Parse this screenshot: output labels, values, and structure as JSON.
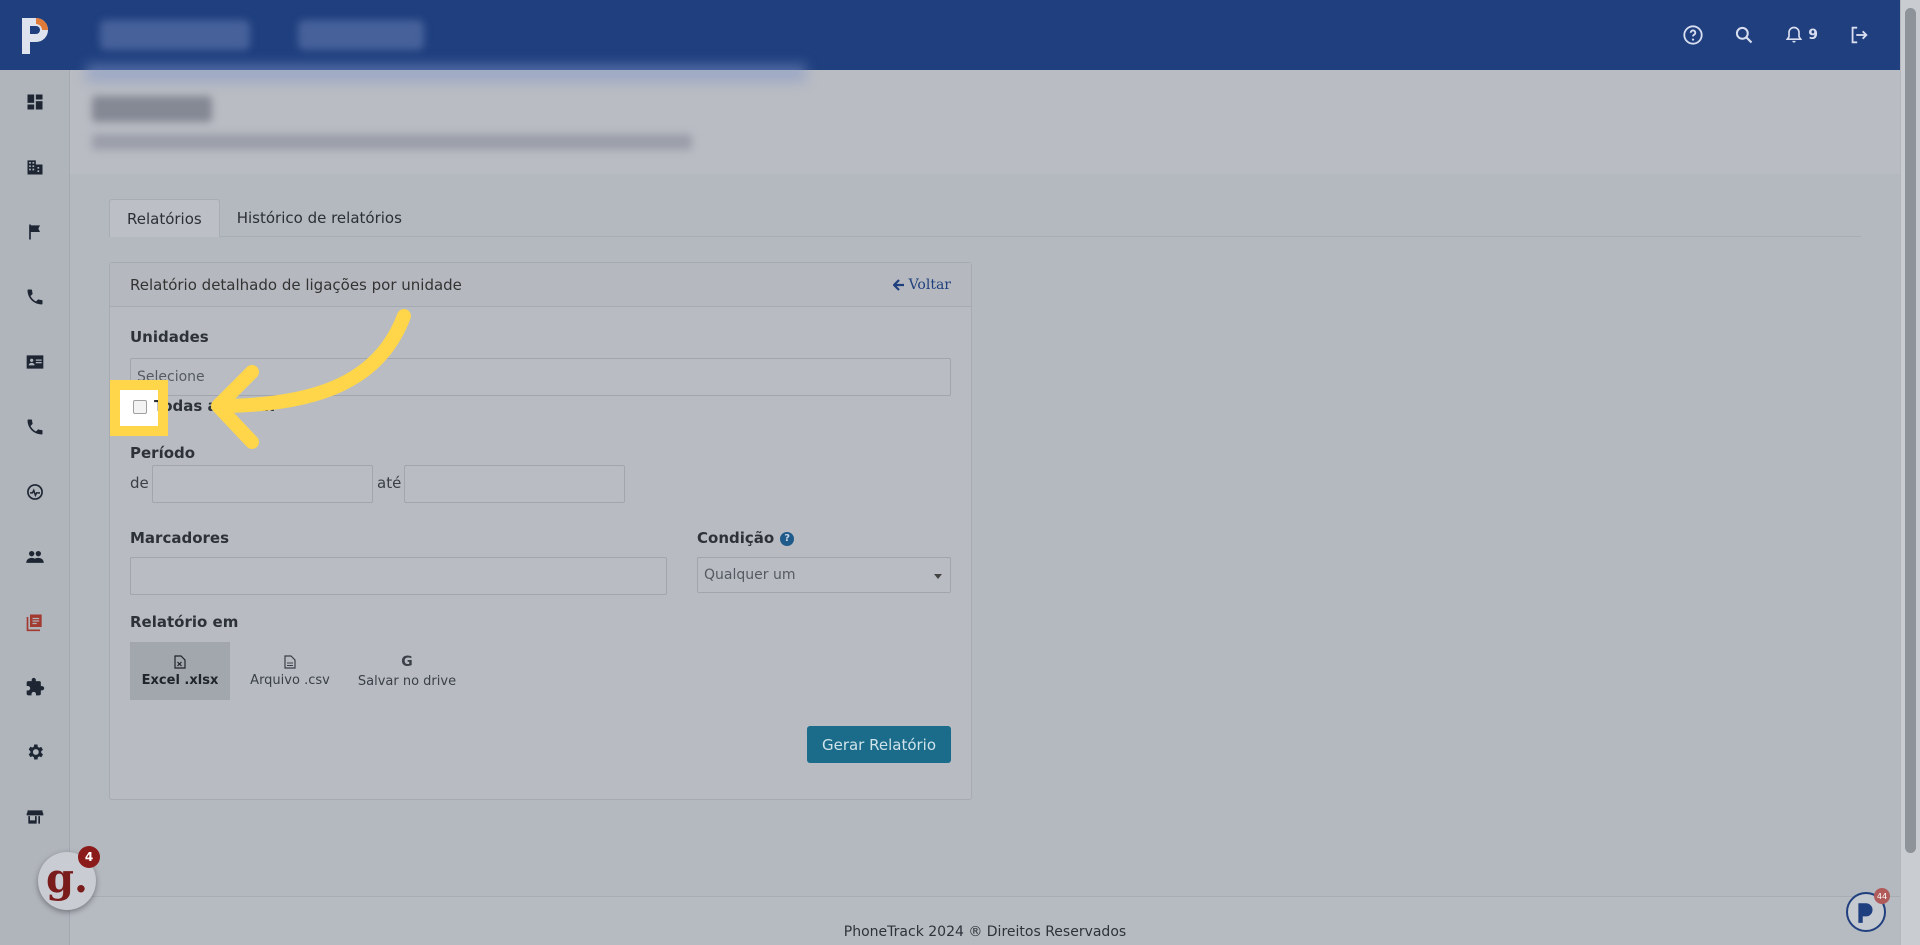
{
  "topbar": {
    "notification_count": "9"
  },
  "tabs": [
    {
      "label": "Relatórios"
    },
    {
      "label": "Histórico de relatórios"
    }
  ],
  "card": {
    "title": "Relatório detalhado de ligações por unidade",
    "back_label": "Voltar",
    "unidades": {
      "label": "Unidades",
      "placeholder": "Selecione",
      "all_checkbox_label": "Todas as unidades"
    },
    "periodo": {
      "label": "Período",
      "from_label": "de",
      "to_label": "até"
    },
    "marcadores": {
      "label": "Marcadores"
    },
    "condicao": {
      "label": "Condição",
      "help": "?",
      "selected": "Qualquer um"
    },
    "relatorio_em": {
      "label": "Relatório em",
      "options": [
        {
          "label": "Excel .xlsx",
          "selected": true
        },
        {
          "label": "Arquivo .csv",
          "selected": false
        },
        {
          "label": "Salvar no drive",
          "selected": false
        }
      ]
    },
    "generate_label": "Gerar Relatório"
  },
  "footer": {
    "text": "PhoneTrack 2024 ® Direitos Reservados"
  },
  "chat_widget": {
    "letter": "g.",
    "badge": "4"
  },
  "corner_widget": {
    "badge": "44"
  },
  "colors": {
    "topbar": "#1f3f7e",
    "primary_button": "#1a6c8a",
    "annotation_arrow": "#ffd54a",
    "active_sidebar": "#a23a30"
  }
}
